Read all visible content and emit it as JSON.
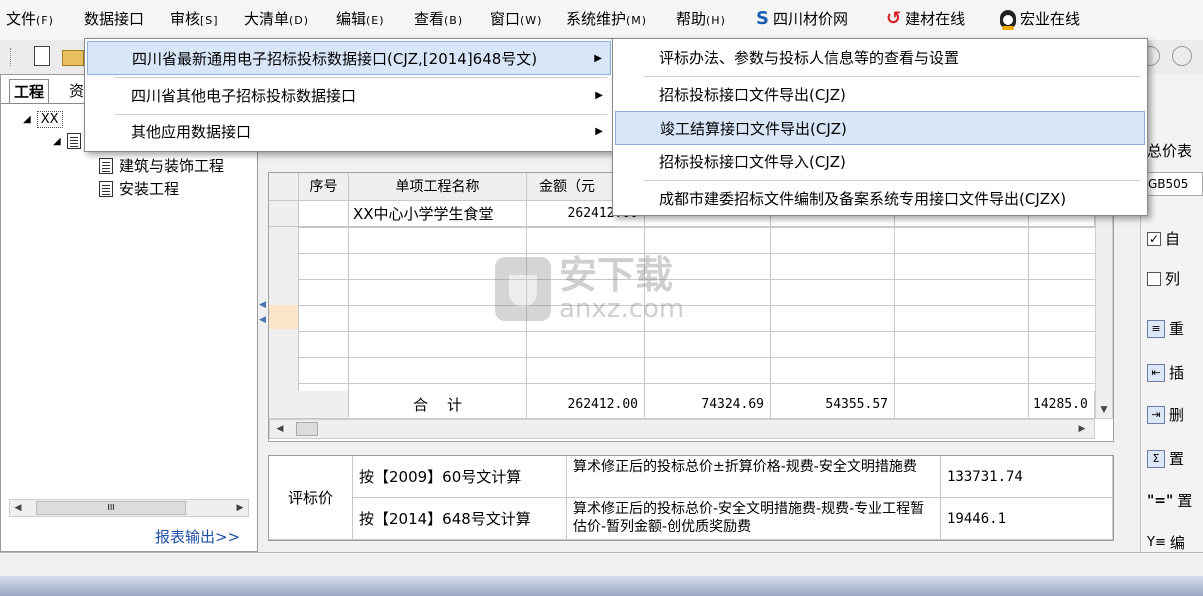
{
  "menubar": {
    "items": [
      {
        "label": "文件",
        "acc": "(F)"
      },
      {
        "label": "数据接口",
        "acc": ""
      },
      {
        "label": "审核",
        "acc": "[S]"
      },
      {
        "label": "大清单",
        "acc": "(D)"
      },
      {
        "label": "编辑",
        "acc": "(E)"
      },
      {
        "label": "查看",
        "acc": "(B)"
      },
      {
        "label": "窗口",
        "acc": "(W)"
      },
      {
        "label": "系统维护",
        "acc": "(M)"
      },
      {
        "label": "帮助",
        "acc": "(H)"
      }
    ],
    "brands": [
      "四川材价网",
      "建材在线",
      "宏业在线"
    ]
  },
  "left_panel": {
    "tabs": [
      "工程",
      "资"
    ],
    "root_label": "XX",
    "tree": [
      "建筑与装饰工程",
      "安装工程"
    ],
    "report_link": "报表输出>>",
    "scroll_glyph": "III"
  },
  "data_menu": {
    "items": [
      {
        "label": "四川省最新通用电子招标投标数据接口(CJZ,[2014]648号文)",
        "has_sub": true
      },
      {
        "label": "四川省其他电子招标投标数据接口",
        "has_sub": true
      },
      {
        "label": "其他应用数据接口",
        "has_sub": true
      }
    ]
  },
  "sub_menu": {
    "items": [
      "评标办法、参数与投标人信息等的查看与设置",
      "招标投标接口文件导出(CJZ)",
      "竣工结算接口文件导出(CJZ)",
      "招标投标接口文件导入(CJZ)",
      "成都市建委招标文件编制及备案系统专用接口文件导出(CJZX)"
    ]
  },
  "grid": {
    "headers": [
      "序号",
      "单项工程名称",
      "金额（元"
    ],
    "rows": [
      {
        "name": "XX中心小学学生食堂",
        "amount": "262412.00"
      }
    ],
    "total": {
      "label": "合    计",
      "values": [
        "262412.00",
        "74324.69",
        "54355.57",
        "",
        "14285.0"
      ]
    }
  },
  "eval": {
    "label": "评标价",
    "rows": [
      {
        "basis": "按【2009】60号文计算",
        "formula": "算术修正后的投标总价±折算价格-规费-安全文明措施费",
        "value": "133731.74"
      },
      {
        "basis": "按【2014】648号文计算",
        "formula": "算术修正后的投标总价-安全文明措施费-规费-专业工程暂估价-暂列金额-创优质奖励费",
        "value": "19446.1"
      }
    ]
  },
  "right_panel": {
    "header": "总价表",
    "code": "GB505",
    "checks": [
      {
        "label": "自",
        "checked": "✓"
      },
      {
        "label": "列",
        "checked": ""
      }
    ],
    "buttons": [
      "重",
      "插",
      "删",
      "置",
      "置",
      "编"
    ]
  },
  "watermark": {
    "cn": "安下载",
    "en": "anxz.com"
  }
}
